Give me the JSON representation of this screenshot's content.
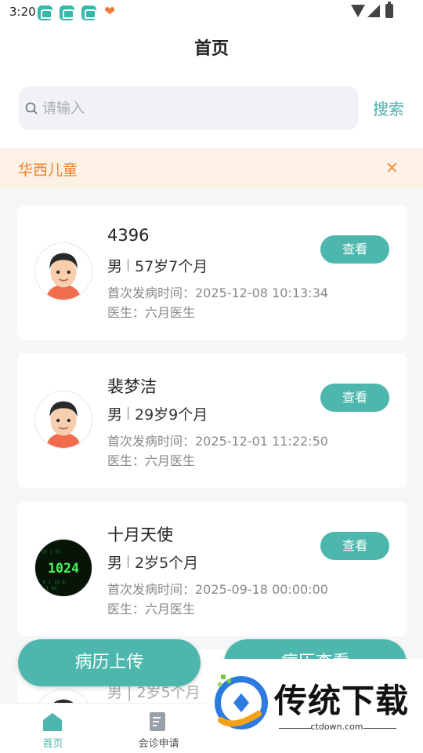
{
  "status_bar": {
    "time": "3:20"
  },
  "header": {
    "title": "首页"
  },
  "search": {
    "placeholder": "请输入",
    "button_label": "搜索"
  },
  "banner": {
    "text": "华西儿童",
    "close": "×"
  },
  "records": [
    {
      "name": "4396",
      "gender": "男",
      "age": "57岁7个月",
      "onset": "首次发病时间：2025-12-08 10:13:34",
      "doctor": "医生：六月医生",
      "view_label": "查看"
    },
    {
      "name": "裴梦洁",
      "gender": "男",
      "age": "29岁9个月",
      "onset": "首次发病时间：2025-12-01 11:22:50",
      "doctor": "医生：六月医生",
      "view_label": "查看"
    },
    {
      "name": "十月天使",
      "gender": "男",
      "age": "2岁5个月",
      "onset": "首次发病时间：2025-09-18 00:00:00",
      "doctor": "医生：六月医生",
      "view_label": "查看",
      "avatar_text": "1024"
    }
  ],
  "partial_record": {
    "text": "男 | 2岁5个月"
  },
  "actions": {
    "upload_label": "病历上传",
    "view_label": "病历查看"
  },
  "tabbar": {
    "tabs": [
      {
        "label": "首页",
        "active": true
      },
      {
        "label": "会诊申请",
        "active": false
      }
    ]
  },
  "watermark": {
    "title": "传统下载",
    "subtitle": "ctdown.com"
  },
  "colors": {
    "accent": "#4db7ad",
    "banner_text": "#f0822b",
    "banner_bg": "#fdf0e4"
  }
}
